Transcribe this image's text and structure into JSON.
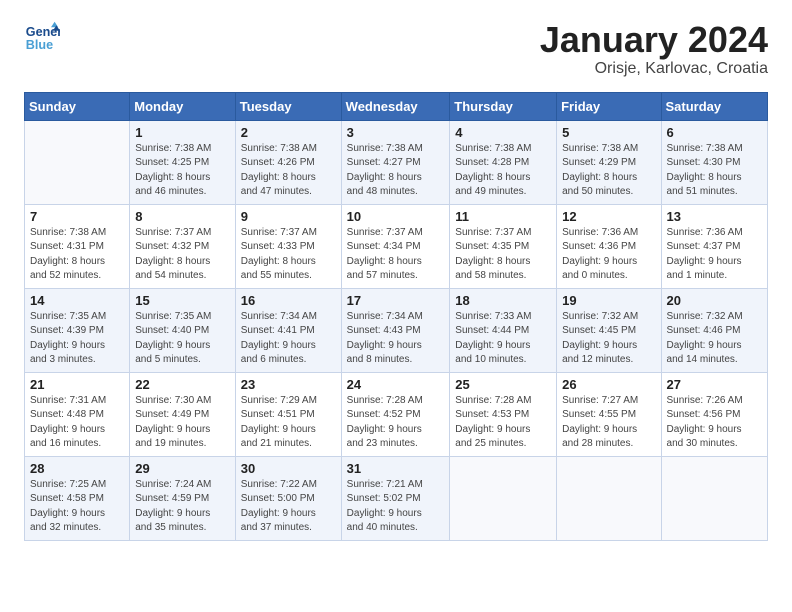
{
  "logo": {
    "line1": "General",
    "line2": "Blue"
  },
  "title": "January 2024",
  "subtitle": "Orisje, Karlovac, Croatia",
  "days_of_week": [
    "Sunday",
    "Monday",
    "Tuesday",
    "Wednesday",
    "Thursday",
    "Friday",
    "Saturday"
  ],
  "weeks": [
    [
      {
        "day": "",
        "info": ""
      },
      {
        "day": "1",
        "info": "Sunrise: 7:38 AM\nSunset: 4:25 PM\nDaylight: 8 hours\nand 46 minutes."
      },
      {
        "day": "2",
        "info": "Sunrise: 7:38 AM\nSunset: 4:26 PM\nDaylight: 8 hours\nand 47 minutes."
      },
      {
        "day": "3",
        "info": "Sunrise: 7:38 AM\nSunset: 4:27 PM\nDaylight: 8 hours\nand 48 minutes."
      },
      {
        "day": "4",
        "info": "Sunrise: 7:38 AM\nSunset: 4:28 PM\nDaylight: 8 hours\nand 49 minutes."
      },
      {
        "day": "5",
        "info": "Sunrise: 7:38 AM\nSunset: 4:29 PM\nDaylight: 8 hours\nand 50 minutes."
      },
      {
        "day": "6",
        "info": "Sunrise: 7:38 AM\nSunset: 4:30 PM\nDaylight: 8 hours\nand 51 minutes."
      }
    ],
    [
      {
        "day": "7",
        "info": "Sunrise: 7:38 AM\nSunset: 4:31 PM\nDaylight: 8 hours\nand 52 minutes."
      },
      {
        "day": "8",
        "info": "Sunrise: 7:37 AM\nSunset: 4:32 PM\nDaylight: 8 hours\nand 54 minutes."
      },
      {
        "day": "9",
        "info": "Sunrise: 7:37 AM\nSunset: 4:33 PM\nDaylight: 8 hours\nand 55 minutes."
      },
      {
        "day": "10",
        "info": "Sunrise: 7:37 AM\nSunset: 4:34 PM\nDaylight: 8 hours\nand 57 minutes."
      },
      {
        "day": "11",
        "info": "Sunrise: 7:37 AM\nSunset: 4:35 PM\nDaylight: 8 hours\nand 58 minutes."
      },
      {
        "day": "12",
        "info": "Sunrise: 7:36 AM\nSunset: 4:36 PM\nDaylight: 9 hours\nand 0 minutes."
      },
      {
        "day": "13",
        "info": "Sunrise: 7:36 AM\nSunset: 4:37 PM\nDaylight: 9 hours\nand 1 minute."
      }
    ],
    [
      {
        "day": "14",
        "info": "Sunrise: 7:35 AM\nSunset: 4:39 PM\nDaylight: 9 hours\nand 3 minutes."
      },
      {
        "day": "15",
        "info": "Sunrise: 7:35 AM\nSunset: 4:40 PM\nDaylight: 9 hours\nand 5 minutes."
      },
      {
        "day": "16",
        "info": "Sunrise: 7:34 AM\nSunset: 4:41 PM\nDaylight: 9 hours\nand 6 minutes."
      },
      {
        "day": "17",
        "info": "Sunrise: 7:34 AM\nSunset: 4:43 PM\nDaylight: 9 hours\nand 8 minutes."
      },
      {
        "day": "18",
        "info": "Sunrise: 7:33 AM\nSunset: 4:44 PM\nDaylight: 9 hours\nand 10 minutes."
      },
      {
        "day": "19",
        "info": "Sunrise: 7:32 AM\nSunset: 4:45 PM\nDaylight: 9 hours\nand 12 minutes."
      },
      {
        "day": "20",
        "info": "Sunrise: 7:32 AM\nSunset: 4:46 PM\nDaylight: 9 hours\nand 14 minutes."
      }
    ],
    [
      {
        "day": "21",
        "info": "Sunrise: 7:31 AM\nSunset: 4:48 PM\nDaylight: 9 hours\nand 16 minutes."
      },
      {
        "day": "22",
        "info": "Sunrise: 7:30 AM\nSunset: 4:49 PM\nDaylight: 9 hours\nand 19 minutes."
      },
      {
        "day": "23",
        "info": "Sunrise: 7:29 AM\nSunset: 4:51 PM\nDaylight: 9 hours\nand 21 minutes."
      },
      {
        "day": "24",
        "info": "Sunrise: 7:28 AM\nSunset: 4:52 PM\nDaylight: 9 hours\nand 23 minutes."
      },
      {
        "day": "25",
        "info": "Sunrise: 7:28 AM\nSunset: 4:53 PM\nDaylight: 9 hours\nand 25 minutes."
      },
      {
        "day": "26",
        "info": "Sunrise: 7:27 AM\nSunset: 4:55 PM\nDaylight: 9 hours\nand 28 minutes."
      },
      {
        "day": "27",
        "info": "Sunrise: 7:26 AM\nSunset: 4:56 PM\nDaylight: 9 hours\nand 30 minutes."
      }
    ],
    [
      {
        "day": "28",
        "info": "Sunrise: 7:25 AM\nSunset: 4:58 PM\nDaylight: 9 hours\nand 32 minutes."
      },
      {
        "day": "29",
        "info": "Sunrise: 7:24 AM\nSunset: 4:59 PM\nDaylight: 9 hours\nand 35 minutes."
      },
      {
        "day": "30",
        "info": "Sunrise: 7:22 AM\nSunset: 5:00 PM\nDaylight: 9 hours\nand 37 minutes."
      },
      {
        "day": "31",
        "info": "Sunrise: 7:21 AM\nSunset: 5:02 PM\nDaylight: 9 hours\nand 40 minutes."
      },
      {
        "day": "",
        "info": ""
      },
      {
        "day": "",
        "info": ""
      },
      {
        "day": "",
        "info": ""
      }
    ]
  ]
}
